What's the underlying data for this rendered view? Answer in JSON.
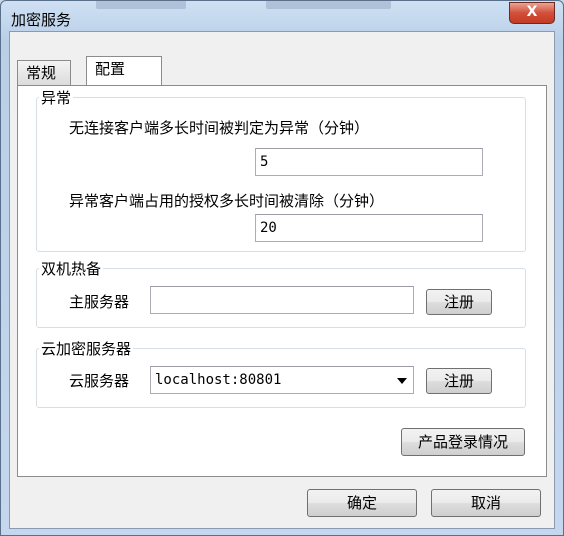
{
  "window": {
    "title": "加密服务",
    "close_glyph": "X"
  },
  "tabs": [
    {
      "label": "常规"
    },
    {
      "label": "配置"
    }
  ],
  "groups": {
    "abnormal": {
      "label": "异常",
      "timeout_label": "无连接客户端多长时间被判定为异常（分钟）",
      "timeout_value": "5",
      "clear_label": "异常客户端占用的授权多长时间被清除（分钟）",
      "clear_value": "20"
    },
    "hotstandby": {
      "label": "双机热备",
      "primary_label": "主服务器",
      "primary_value": "",
      "register_label": "注册"
    },
    "cloud": {
      "label": "云加密服务器",
      "server_label": "云服务器",
      "server_value": "localhost:80801",
      "register_label": "注册"
    }
  },
  "product_login_label": "产品登录情况",
  "footer": {
    "ok_label": "确定",
    "cancel_label": "取消"
  },
  "colors": {
    "close_red": "#c33a24",
    "frame": "#c9d9ec"
  }
}
